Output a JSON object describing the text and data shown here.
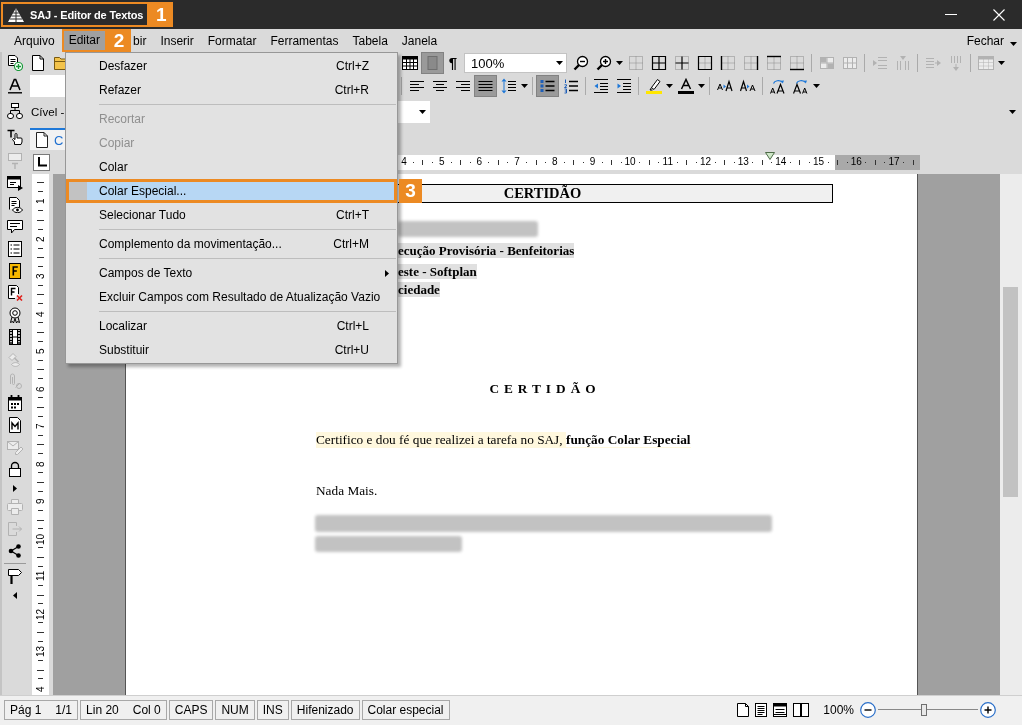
{
  "window": {
    "title": "SAJ - Editor de Textos",
    "callout": "1"
  },
  "menu_bar": {
    "items": [
      {
        "label": "Arquivo",
        "selected": false
      },
      {
        "label": "Editar",
        "selected": true,
        "callout": "2"
      },
      {
        "label": "bir",
        "selected": false
      },
      {
        "label": "Inserir",
        "selected": false
      },
      {
        "label": "Formatar",
        "selected": false
      },
      {
        "label": "Ferramentas",
        "selected": false
      },
      {
        "label": "Tabela",
        "selected": false
      },
      {
        "label": "Janela",
        "selected": false
      }
    ],
    "close_label": "Fechar"
  },
  "edit_menu": {
    "items": [
      {
        "kind": "item",
        "label": "Desfazer",
        "shortcut": "Ctrl+Z",
        "disabled": false,
        "selected": false,
        "submenu": false
      },
      {
        "kind": "item",
        "label": "Refazer",
        "shortcut": "Ctrl+R",
        "disabled": false,
        "selected": false,
        "submenu": false
      },
      {
        "kind": "separator"
      },
      {
        "kind": "item",
        "label": "Recortar",
        "disabled": true,
        "selected": false,
        "submenu": false
      },
      {
        "kind": "item",
        "label": "Copiar",
        "disabled": true,
        "selected": false,
        "submenu": false
      },
      {
        "kind": "item",
        "label": "Colar",
        "disabled": false,
        "selected": false,
        "submenu": false
      },
      {
        "kind": "item",
        "label": "Colar Especial...",
        "disabled": false,
        "selected": true,
        "submenu": false,
        "callout": "3"
      },
      {
        "kind": "item",
        "label": "Selecionar Tudo",
        "shortcut": "Ctrl+T",
        "disabled": false,
        "selected": false,
        "submenu": false
      },
      {
        "kind": "separator"
      },
      {
        "kind": "item",
        "label": "Complemento da movimentação...",
        "shortcut": "Ctrl+M",
        "disabled": false,
        "selected": false,
        "submenu": false
      },
      {
        "kind": "separator"
      },
      {
        "kind": "item",
        "label": "Campos de Texto",
        "disabled": false,
        "selected": false,
        "submenu": true
      },
      {
        "kind": "item",
        "label": "Excluir Campos com Resultado de Atualização Vazio",
        "disabled": false,
        "selected": false,
        "submenu": false
      },
      {
        "kind": "separator"
      },
      {
        "kind": "item",
        "label": "Localizar",
        "shortcut": "Ctrl+L",
        "disabled": false,
        "selected": false,
        "submenu": false
      },
      {
        "kind": "item",
        "label": "Substituir",
        "shortcut": "Ctrl+U",
        "disabled": false,
        "selected": false,
        "submenu": false
      }
    ]
  },
  "side_toolbar": [
    {
      "kind": "button",
      "disabled": false
    },
    {
      "kind": "button",
      "disabled": false
    },
    {
      "kind": "button",
      "disabled": false
    },
    {
      "kind": "button",
      "disabled": false
    },
    {
      "kind": "button",
      "disabled": true
    },
    {
      "kind": "button",
      "disabled": false
    },
    {
      "kind": "button",
      "disabled": false
    },
    {
      "kind": "button",
      "disabled": false
    },
    {
      "kind": "button",
      "disabled": false
    },
    {
      "kind": "button",
      "disabled": false
    },
    {
      "kind": "button",
      "disabled": false
    },
    {
      "kind": "button",
      "disabled": false
    },
    {
      "kind": "button",
      "disabled": false
    },
    {
      "kind": "button",
      "disabled": true
    },
    {
      "kind": "button",
      "disabled": true
    },
    {
      "kind": "button",
      "disabled": false
    },
    {
      "kind": "button",
      "disabled": false
    },
    {
      "kind": "button",
      "disabled": true
    },
    {
      "kind": "button",
      "disabled": false
    },
    {
      "kind": "caret"
    },
    {
      "kind": "button",
      "disabled": true
    },
    {
      "kind": "button",
      "disabled": true
    },
    {
      "kind": "button",
      "disabled": false
    },
    {
      "kind": "separator"
    },
    {
      "kind": "button",
      "disabled": false
    },
    {
      "kind": "caret"
    }
  ],
  "toolbar": {
    "context_label": "Cível -",
    "row_1": [
      {
        "kind": "button",
        "selected": false,
        "disabled": false
      },
      {
        "kind": "button",
        "selected": true,
        "disabled": false
      },
      {
        "kind": "text",
        "label": "¶",
        "selected": false,
        "disabled": false
      },
      {
        "kind": "combo",
        "value": "100%"
      },
      {
        "kind": "button",
        "selected": false,
        "disabled": false
      },
      {
        "kind": "button",
        "selected": false,
        "disabled": false
      },
      {
        "kind": "caret"
      },
      {
        "kind": "button",
        "selected": false,
        "disabled": false
      },
      {
        "kind": "button",
        "selected": false,
        "disabled": false
      },
      {
        "kind": "button",
        "selected": false,
        "disabled": false
      },
      {
        "kind": "button",
        "selected": false,
        "disabled": false
      },
      {
        "kind": "button",
        "selected": false,
        "disabled": false
      },
      {
        "kind": "button",
        "selected": false,
        "disabled": false
      },
      {
        "kind": "button",
        "selected": false,
        "disabled": false
      },
      {
        "kind": "button",
        "selected": false,
        "disabled": false
      },
      {
        "kind": "separator"
      },
      {
        "kind": "button",
        "selected": false,
        "disabled": true
      },
      {
        "kind": "button",
        "selected": false,
        "disabled": true
      },
      {
        "kind": "separator"
      },
      {
        "kind": "button",
        "selected": false,
        "disabled": true
      },
      {
        "kind": "button",
        "selected": false,
        "disabled": true
      },
      {
        "kind": "separator"
      },
      {
        "kind": "button",
        "selected": false,
        "disabled": true
      },
      {
        "kind": "button",
        "selected": false,
        "disabled": true
      },
      {
        "kind": "separator"
      },
      {
        "kind": "button",
        "selected": false,
        "disabled": true
      },
      {
        "kind": "caret"
      }
    ],
    "row_2": [
      {
        "kind": "separator"
      },
      {
        "kind": "button",
        "selected": false,
        "disabled": false
      },
      {
        "kind": "button",
        "selected": false,
        "disabled": false
      },
      {
        "kind": "button",
        "selected": false,
        "disabled": false
      },
      {
        "kind": "button",
        "selected": true,
        "disabled": false
      },
      {
        "kind": "button",
        "selected": false,
        "disabled": false
      },
      {
        "kind": "caret"
      },
      {
        "kind": "separator"
      },
      {
        "kind": "button",
        "selected": true,
        "disabled": false
      },
      {
        "kind": "button",
        "selected": false,
        "disabled": false
      },
      {
        "kind": "separator"
      },
      {
        "kind": "button",
        "selected": false,
        "disabled": false
      },
      {
        "kind": "button",
        "selected": false,
        "disabled": false
      },
      {
        "kind": "separator"
      },
      {
        "kind": "button",
        "selected": false,
        "disabled": false
      },
      {
        "kind": "caret"
      },
      {
        "kind": "button",
        "selected": false,
        "disabled": false
      },
      {
        "kind": "caret"
      },
      {
        "kind": "separator"
      },
      {
        "kind": "button",
        "selected": false,
        "disabled": false
      },
      {
        "kind": "button",
        "selected": false,
        "disabled": false
      },
      {
        "kind": "separator"
      },
      {
        "kind": "button",
        "selected": false,
        "disabled": false
      },
      {
        "kind": "button",
        "selected": false,
        "disabled": false
      },
      {
        "kind": "caret"
      }
    ]
  },
  "document_tabs": [
    {
      "label": "C",
      "selected": true
    }
  ],
  "ruler": {
    "labels": [
      "4",
      "5",
      "6",
      "7",
      "8",
      "9",
      "10",
      "11",
      "12",
      "13",
      "14",
      "15",
      "16",
      "17"
    ]
  },
  "vertical_ruler": {
    "labels": [
      "1",
      "2",
      "3",
      "4",
      "5",
      "6",
      "7",
      "8",
      "9",
      "10",
      "11",
      "12",
      "13",
      "4"
    ]
  },
  "document": {
    "header": "CERTIDÃO",
    "field_lines": [
      {
        "text": "ecução Provisória - Benfeitorias",
        "highlighted": true
      },
      {
        "text": "este - Softplan",
        "highlighted": true
      },
      {
        "text": "ciedade",
        "highlighted": true
      }
    ],
    "title": "CERTIDÃO",
    "paragraphs": [
      {
        "text": "Certifico e dou fé que realizei a tarefa no SAJ, **função Colar Especial**",
        "highlighted": true
      },
      {
        "text": "Nada Mais.",
        "highlighted": false
      }
    ]
  },
  "status_bar": {
    "cells": [
      {
        "items": [
          "Pág 1",
          "1/1"
        ]
      },
      {
        "items": [
          "Lin 20",
          "Col 0"
        ]
      },
      {
        "items": [
          "CAPS"
        ]
      },
      {
        "items": [
          "NUM"
        ]
      },
      {
        "items": [
          "INS"
        ]
      },
      {
        "items": [
          "Hifenizado"
        ]
      },
      {
        "items": [
          "Colar especial"
        ]
      }
    ],
    "zoom_label": "100%",
    "zoom": {
      "level": 0.46
    }
  }
}
